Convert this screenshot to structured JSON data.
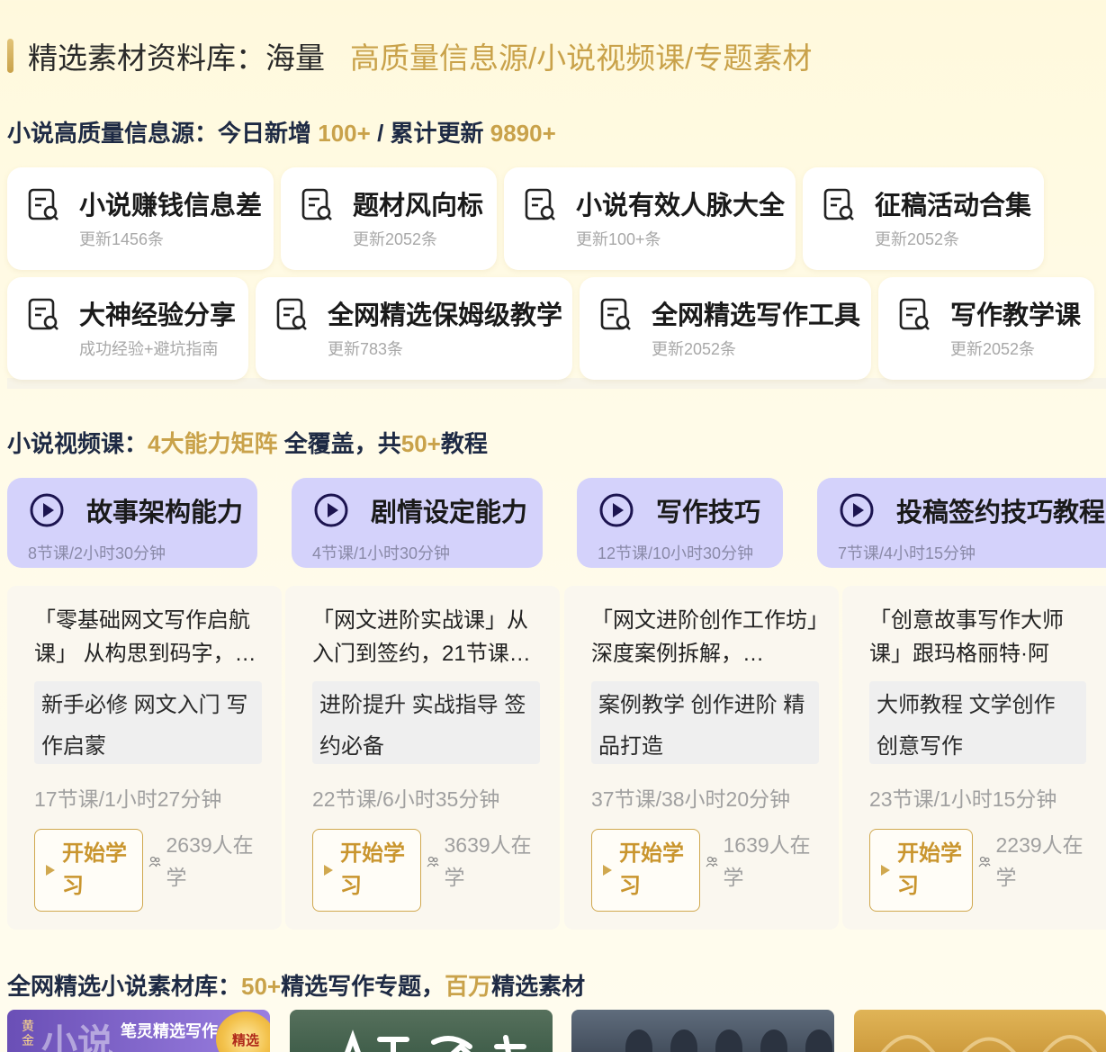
{
  "hero": {
    "main": "精选素材资料库：海量",
    "highlight": "高质量信息源/小说视频课/专题素材"
  },
  "info_section": {
    "prefix": "小说高质量信息源：今日新增",
    "today": "100+",
    "sep": "/ 累计更新",
    "total": "9890+"
  },
  "info_cards": [
    {
      "title": "小说赚钱信息差",
      "sub": "更新1456条"
    },
    {
      "title": "题材风向标",
      "sub": "更新2052条"
    },
    {
      "title": "小说有效人脉大全",
      "sub": "更新100+条"
    },
    {
      "title": "征稿活动合集",
      "sub": "更新2052条"
    },
    {
      "title": "大神经验分享",
      "sub": "成功经验+避坑指南"
    },
    {
      "title": "全网精选保姆级教学",
      "sub": "更新783条"
    },
    {
      "title": "全网精选写作工具",
      "sub": "更新2052条"
    },
    {
      "title": "写作教学课",
      "sub": "更新2052条"
    }
  ],
  "video_section": {
    "prefix": "小说视频课：",
    "highlight": "4大能力矩阵",
    "mid": "全覆盖，共",
    "count": "50+",
    "suffix": "教程"
  },
  "categories": [
    {
      "title": "故事架构能力",
      "sub": "8节课/2小时30分钟"
    },
    {
      "title": "剧情设定能力",
      "sub": "4节课/1小时30分钟"
    },
    {
      "title": "写作技巧",
      "sub": "12节课/10小时30分钟"
    },
    {
      "title": "投稿签约技巧教程",
      "sub": "7节课/4小时15分钟"
    }
  ],
  "courses": [
    {
      "title": "「零基础网文写作启航课」 从构思到码字，…",
      "tags": "新手必修 网文入门 写作启蒙",
      "meta": "17节课/1小时27分钟",
      "button": "开始学习",
      "learners": "2639人在学"
    },
    {
      "title": "「网文进阶实战课」从入门到签约，21节课…",
      "tags": "进阶提升 实战指导 签约必备",
      "meta": "22节课/6小时35分钟",
      "button": "开始学习",
      "learners": "3639人在学"
    },
    {
      "title": "「网文进阶创作工作坊」深度案例拆解，…",
      "tags": "案例教学 创作进阶 精品打造",
      "meta": "37节课/38小时20分钟",
      "button": "开始学习",
      "learners": "1639人在学"
    },
    {
      "title": "「创意故事写作大师课」跟玛格丽特·阿特…",
      "tags": "大师教程 文学创作 创意写作",
      "meta": "23节课/1小时15分钟",
      "button": "开始学习",
      "learners": "2239人在学"
    }
  ],
  "material_section": {
    "prefix": "全网精选小说素材库：",
    "count": "50+",
    "mid": "精选写作专题，",
    "highlight": "百万",
    "suffix": "精选素材"
  },
  "thumbnails": {
    "t1_vertical": "黄金",
    "t1_big": "小说",
    "t1_small": "笔灵精选写作",
    "t1_badge": "精选"
  },
  "colors": {
    "gold": "#c9a24a",
    "category_bg": "#d4d2fb",
    "title": "#1e2a44"
  }
}
